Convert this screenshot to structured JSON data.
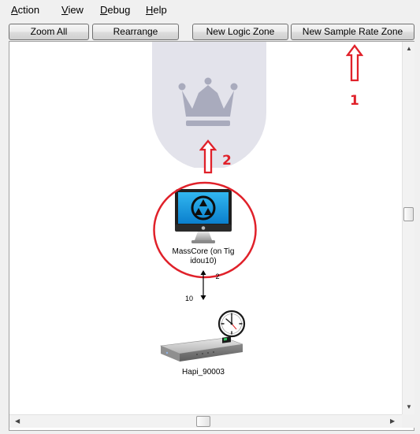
{
  "menu": {
    "items": [
      {
        "first": "A",
        "rest": "ction"
      },
      {
        "first": "V",
        "rest": "iew"
      },
      {
        "first": "D",
        "rest": "ebug"
      },
      {
        "first": "H",
        "rest": "elp"
      }
    ]
  },
  "toolbar": {
    "zoom_all": "Zoom All",
    "rearrange": "Rearrange",
    "new_logic_zone": "New Logic Zone",
    "new_sample_rate_zone": "New Sample Rate Zone"
  },
  "nodes": {
    "masscore": {
      "label_line1": "MassCore (on Tig",
      "label_line2": "idou10)"
    },
    "hapi": {
      "label": "Hapi_90003"
    },
    "connection": {
      "port_top": "2",
      "port_bottom": "10"
    }
  },
  "annotations": {
    "one": "1",
    "two": "2",
    "color": "#e0212a"
  },
  "icons": {
    "crown": "crown-icon",
    "computer": "masscore-computer-icon",
    "clock": "clock-icon",
    "device": "hapi-device-icon"
  }
}
